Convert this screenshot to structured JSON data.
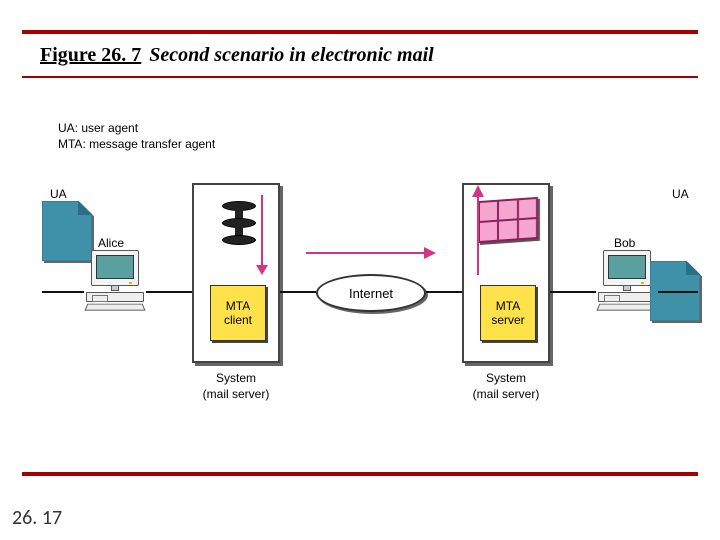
{
  "figure": {
    "number_label": "Figure 26. 7",
    "caption": "Second scenario in electronic mail"
  },
  "page_number": "26. 17",
  "legend": {
    "ua": "UA: user agent",
    "mta": "MTA: message transfer agent"
  },
  "labels": {
    "ua": "UA",
    "alice": "Alice",
    "bob": "Bob",
    "mta_client": "MTA\nclient",
    "mta_server": "MTA\nserver",
    "internet": "Internet",
    "system": "System",
    "mail_server": "(mail server)"
  }
}
